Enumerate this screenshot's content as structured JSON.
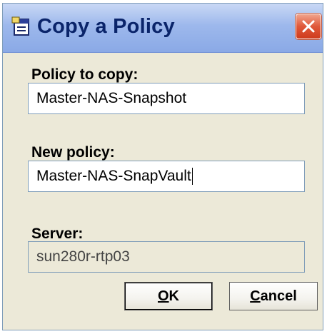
{
  "dialog": {
    "title": "Copy a Policy",
    "icon": "window-icon",
    "close_icon": "close-icon"
  },
  "fields": {
    "policy_to_copy": {
      "label": "Policy to copy:",
      "value": "Master-NAS-Snapshot"
    },
    "new_policy": {
      "label": "New policy:",
      "value": "Master-NAS-SnapVault"
    },
    "server": {
      "label": "Server:",
      "value": "sun280r-rtp03"
    }
  },
  "buttons": {
    "ok": {
      "label_underlined": "O",
      "label_rest": "K"
    },
    "cancel": {
      "label_underlined": "C",
      "label_rest": "ancel"
    }
  },
  "colors": {
    "title_text": "#0a246a",
    "dialog_bg": "#ece9d8",
    "close_button": "#e0583a"
  }
}
